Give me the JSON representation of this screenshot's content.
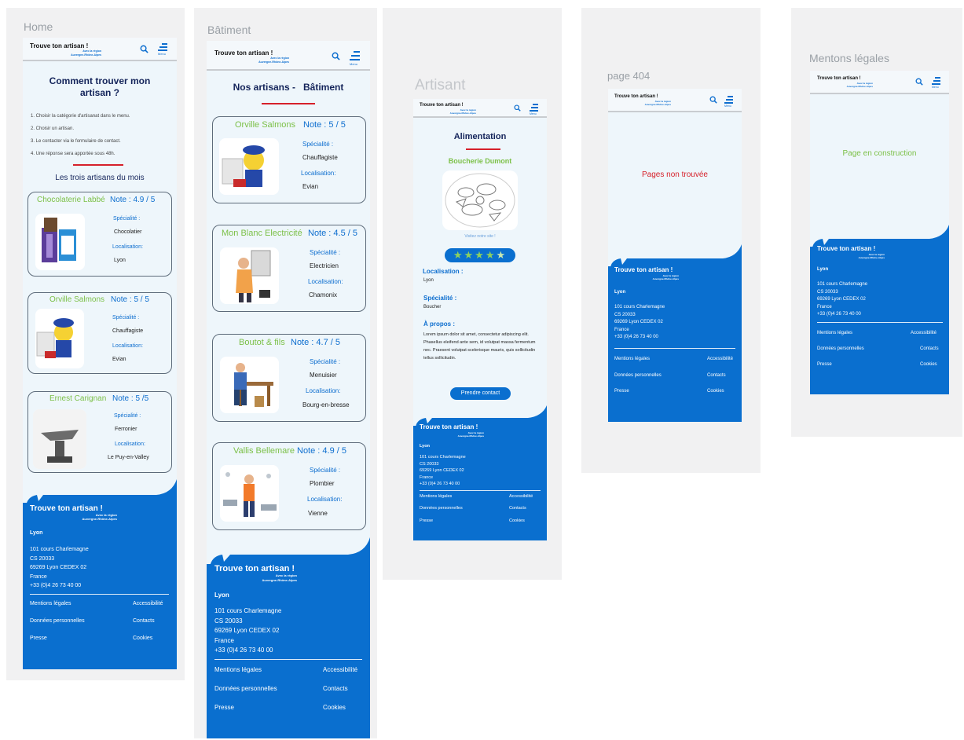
{
  "brand": {
    "name": "Trouve ton artisan !",
    "sub1": "Avec la région",
    "sub2": "Auvergne-Rhône-Alpes",
    "menu_label": "Menu"
  },
  "footer": {
    "city": "Lyon",
    "address": [
      "101 cours Charlemagne",
      "CS 20033",
      "69269 Lyon CEDEX 02",
      "France",
      "+33 (0)4 26 73 40 00"
    ],
    "links": {
      "legal": "Mentions légales",
      "accessibility": "Accessibilité",
      "personal": "Données personnelles",
      "contacts": "Contacts",
      "press": "Presse",
      "cookies": "Cookies"
    }
  },
  "frames": {
    "home": "Home",
    "batiment": "Bâtiment",
    "artisant": "Artisant",
    "page404": "page 404",
    "mentions": "Mentons légales"
  },
  "home": {
    "title": "Comment trouver mon artisan ?",
    "steps": [
      "1. Choisir la catégorie d'artisanat dans le menu.",
      "2. Choisir un artisan.",
      "3. Le contacter via le formulaire de contact.",
      "4. Une réponse sera apportée sous 48h."
    ],
    "subtitle": "Les trois artisans du mois",
    "cards": [
      {
        "name": "Chocolaterie Labbé",
        "note": "Note : 4.9 / 5",
        "spec_label": "Spécialité :",
        "spec": "Chocolatier",
        "loc_label": "Localisation:",
        "loc": "Lyon"
      },
      {
        "name": "Orville Salmons",
        "note": "Note : 5 / 5",
        "spec_label": "Spécialité :",
        "spec": "Chauffagiste",
        "loc_label": "Localisation:",
        "loc": "Evian"
      },
      {
        "name": "Ernest Carignan",
        "note": "Note : 5 /5",
        "spec_label": "Spécialité :",
        "spec": "Ferronier",
        "loc_label": "Localisation:",
        "loc": "Le Puy-en-Valley"
      }
    ]
  },
  "batiment": {
    "title": "Nos artisans -   Bâtiment",
    "cards": [
      {
        "name": "Orville Salmons",
        "note": "Note : 5 / 5",
        "spec_label": "Spécialité :",
        "spec": "Chauffagiste",
        "loc_label": "Localisation:",
        "loc": "Evian"
      },
      {
        "name": "Mon Blanc Electricité",
        "note": "Note : 4.5 / 5",
        "spec_label": "Spécialité :",
        "spec": "Electricien",
        "loc_label": "Localisation:",
        "loc": "Chamonix"
      },
      {
        "name": "Boutot & fils",
        "note": "Note : 4.7 / 5",
        "spec_label": "Spécialité :",
        "spec": "Menuisier",
        "loc_label": "Localisation:",
        "loc": "Bourg-en-bresse"
      },
      {
        "name": "Vallis Bellemare",
        "note": "Note : 4.9 / 5",
        "spec_label": "Spécialité :",
        "spec": "Plombier",
        "loc_label": "Localisation:",
        "loc": "Vienne"
      }
    ]
  },
  "artisan": {
    "category": "Alimentation",
    "name": "Boucherie Dumont",
    "caption": "Visitez notre site !",
    "rating_stars": 4.5,
    "loc_label": "Localisation :",
    "loc": "Lyon",
    "spec_label": "Spécialité :",
    "spec": "Boucher",
    "about_label": "À propos :",
    "about": "Lorem ipsum dolor sit amet, consectetur adipiscing elit. Phasellus eleifend ante sem, id volutpat massa fermentum nec. Praesent volutpat scelerisque mauris, quis sollicitudin tellus sollicitudin.",
    "button": "Prendre contact"
  },
  "page404": {
    "message": "Pages non trouvée"
  },
  "mentions": {
    "message": "Page en construction"
  },
  "colors": {
    "accent_blue": "#0a6fcf",
    "green": "#7cc048",
    "navy": "#14245a",
    "red": "#d6202a"
  }
}
